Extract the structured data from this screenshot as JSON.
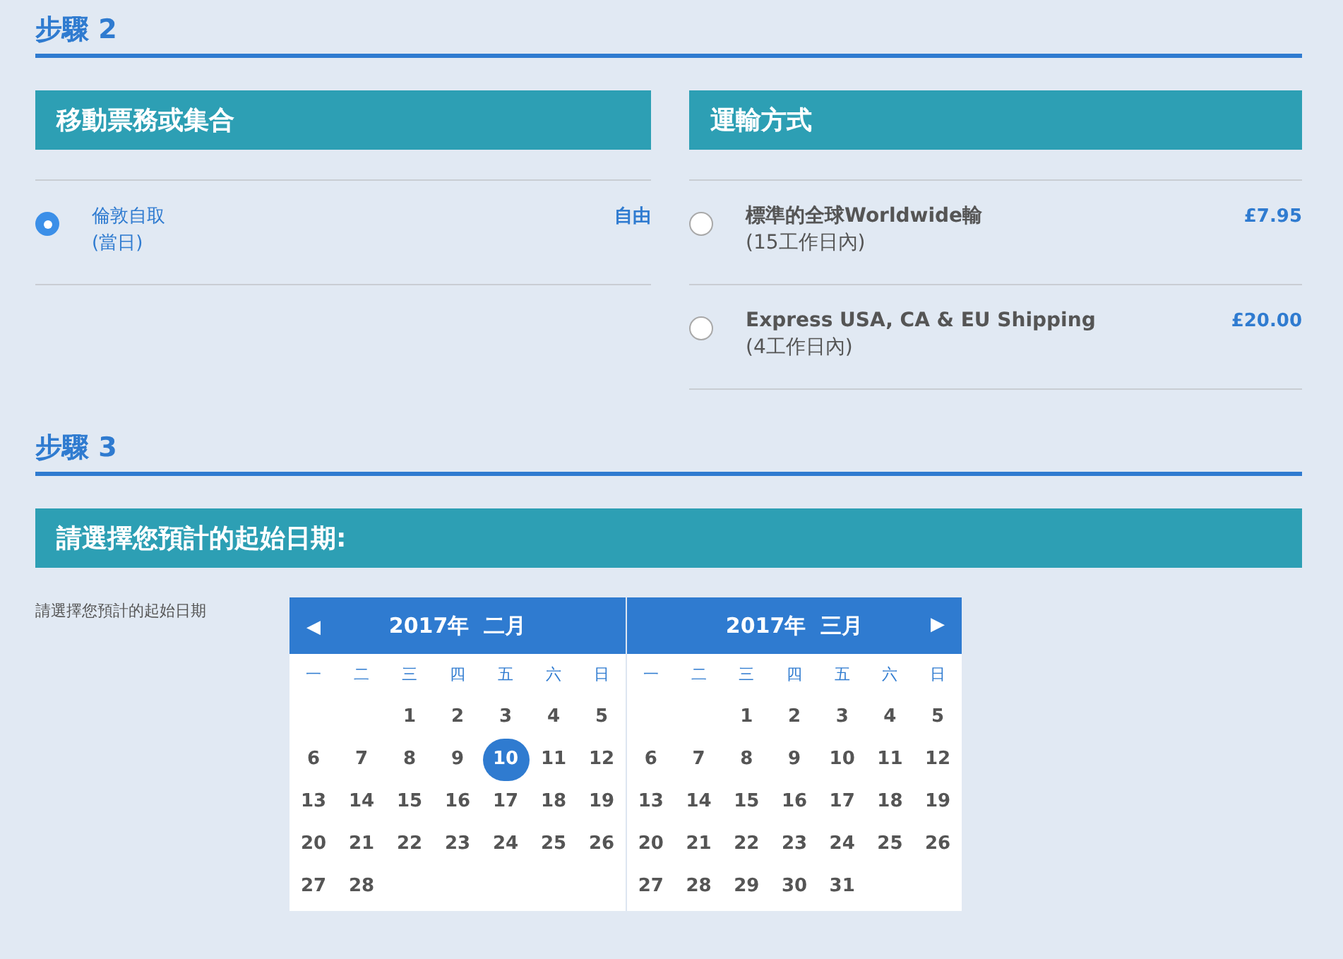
{
  "step2": {
    "heading": "步驟 2",
    "pickup": {
      "title": "移動票務或集合",
      "options": [
        {
          "name": "倫敦自取",
          "note": "(當日)",
          "price": "自由",
          "selected": true
        }
      ]
    },
    "shipping": {
      "title": "運輸方式",
      "options": [
        {
          "name": "標準的全球Worldwide輸",
          "note": "(15工作日內)",
          "price": "£7.95",
          "selected": false
        },
        {
          "name": "Express USA, CA & EU Shipping",
          "note": "(4工作日內)",
          "price": "£20.00",
          "selected": false
        }
      ]
    }
  },
  "step3": {
    "heading": "步驟 3",
    "title": "請選擇您預計的起始日期:",
    "label": "請選擇您預計的起始日期",
    "calendar": {
      "prev": "◀",
      "next": "▶",
      "months": [
        {
          "title": "2017年  二月",
          "weekdays": [
            "一",
            "二",
            "三",
            "四",
            "五",
            "六",
            "日"
          ],
          "weeks": [
            [
              {
                "day": "1",
                "selected": false
              },
              {
                "day": "2",
                "selected": false
              },
              {
                "day": "3",
                "selected": false
              },
              {
                "day": "4",
                "selected": false
              },
              {
                "day": "5",
                "selected": false
              }
            ],
            [
              {
                "day": "6",
                "selected": false
              },
              {
                "day": "7",
                "selected": false
              },
              {
                "day": "8",
                "selected": false
              },
              {
                "day": "9",
                "selected": false
              },
              {
                "day": "10",
                "selected": true
              },
              {
                "day": "11",
                "selected": false
              },
              {
                "day": "12",
                "selected": false
              }
            ],
            [
              {
                "day": "13",
                "selected": false
              },
              {
                "day": "14",
                "selected": false
              },
              {
                "day": "15",
                "selected": false
              },
              {
                "day": "16",
                "selected": false
              },
              {
                "day": "17",
                "selected": false
              },
              {
                "day": "18",
                "selected": false
              },
              {
                "day": "19",
                "selected": false
              }
            ],
            [
              {
                "day": "20",
                "selected": false
              },
              {
                "day": "21",
                "selected": false
              },
              {
                "day": "22",
                "selected": false
              },
              {
                "day": "23",
                "selected": false
              },
              {
                "day": "24",
                "selected": false
              },
              {
                "day": "25",
                "selected": false
              },
              {
                "day": "26",
                "selected": false
              }
            ],
            [
              {
                "day": "27",
                "selected": false
              },
              {
                "day": "28",
                "selected": false
              }
            ]
          ]
        },
        {
          "title": "2017年  三月",
          "weekdays": [
            "一",
            "二",
            "三",
            "四",
            "五",
            "六",
            "日"
          ],
          "weeks": [
            [
              {
                "day": "1",
                "selected": false
              },
              {
                "day": "2",
                "selected": false
              },
              {
                "day": "3",
                "selected": false
              },
              {
                "day": "4",
                "selected": false
              },
              {
                "day": "5",
                "selected": false
              }
            ],
            [
              {
                "day": "6",
                "selected": false
              },
              {
                "day": "7",
                "selected": false
              },
              {
                "day": "8",
                "selected": false
              },
              {
                "day": "9",
                "selected": false
              },
              {
                "day": "10",
                "selected": false
              },
              {
                "day": "11",
                "selected": false
              },
              {
                "day": "12",
                "selected": false
              }
            ],
            [
              {
                "day": "13",
                "selected": false
              },
              {
                "day": "14",
                "selected": false
              },
              {
                "day": "15",
                "selected": false
              },
              {
                "day": "16",
                "selected": false
              },
              {
                "day": "17",
                "selected": false
              },
              {
                "day": "18",
                "selected": false
              },
              {
                "day": "19",
                "selected": false
              }
            ],
            [
              {
                "day": "20",
                "selected": false
              },
              {
                "day": "21",
                "selected": false
              },
              {
                "day": "22",
                "selected": false
              },
              {
                "day": "23",
                "selected": false
              },
              {
                "day": "24",
                "selected": false
              },
              {
                "day": "25",
                "selected": false
              },
              {
                "day": "26",
                "selected": false
              }
            ],
            [
              {
                "day": "27",
                "selected": false
              },
              {
                "day": "28",
                "selected": false
              },
              {
                "day": "29",
                "selected": false
              },
              {
                "day": "30",
                "selected": false
              },
              {
                "day": "31",
                "selected": false
              }
            ]
          ]
        }
      ]
    }
  }
}
